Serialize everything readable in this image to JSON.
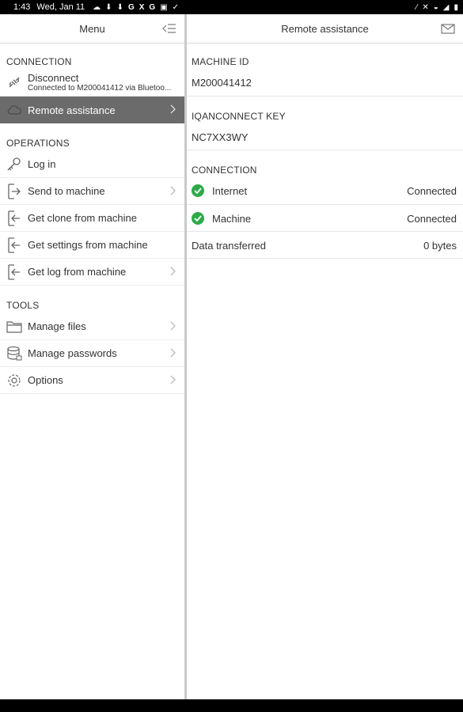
{
  "status_bar": {
    "time": "1:43",
    "date": "Wed, Jan 11",
    "notification_icons": [
      "cloud-icon",
      "download-icon",
      "download-icon",
      "google-icon",
      "x-icon",
      "google-icon",
      "photo-icon",
      "check-icon"
    ],
    "system_icons": [
      "mute-icon",
      "wifi-icon",
      "signal-icon",
      "battery-icon"
    ]
  },
  "left_pane": {
    "title": "Menu",
    "sections": [
      {
        "header": "CONNECTION",
        "items": [
          {
            "label": "Disconnect",
            "sublabel": "Connected to M200041412 via Bluetoo...",
            "icon": "plug-icon"
          },
          {
            "label": "Remote assistance",
            "icon": "cloud-icon",
            "selected": true
          }
        ]
      },
      {
        "header": "OPERATIONS",
        "items": [
          {
            "label": "Log in",
            "icon": "key-icon"
          },
          {
            "label": "Send to machine",
            "icon": "send-icon"
          },
          {
            "label": "Get clone from machine",
            "icon": "receive-icon"
          },
          {
            "label": "Get settings from machine",
            "icon": "receive-icon"
          },
          {
            "label": "Get log from machine",
            "icon": "receive-icon"
          }
        ]
      },
      {
        "header": "TOOLS",
        "items": [
          {
            "label": "Manage files",
            "icon": "folder-icon"
          },
          {
            "label": "Manage passwords",
            "icon": "database-icon"
          },
          {
            "label": "Options",
            "icon": "gear-icon"
          }
        ]
      }
    ]
  },
  "right_pane": {
    "title": "Remote assistance",
    "machine_id_header": "MACHINE ID",
    "machine_id": "M200041412",
    "key_header": "IQANCONNECT KEY",
    "key": "NC7XX3WY",
    "connection_header": "CONNECTION",
    "rows": [
      {
        "label": "Internet",
        "value": "Connected",
        "status": "ok"
      },
      {
        "label": "Machine",
        "value": "Connected",
        "status": "ok"
      },
      {
        "label": "Data transferred",
        "value": "0 bytes"
      }
    ]
  },
  "colors": {
    "selected_bg": "#6b6b6b",
    "ok_green": "#2eaa4a",
    "divider": "#c9c9c9"
  }
}
